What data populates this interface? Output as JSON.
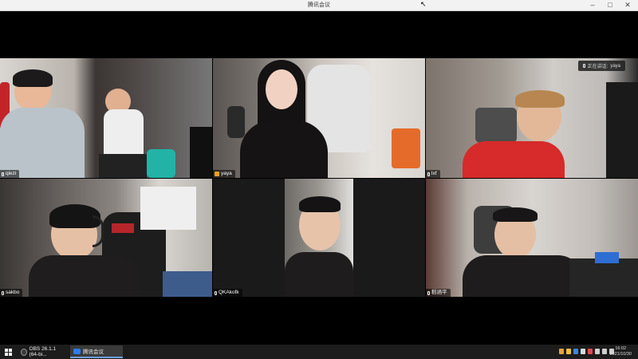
{
  "window": {
    "title": "腾讯会议"
  },
  "speaking": {
    "prefix": "正在讲话:",
    "name": "yaya"
  },
  "participants": [
    {
      "name": "qiezi",
      "active": false
    },
    {
      "name": "yaya",
      "active": true
    },
    {
      "name": "lxf",
      "active": false
    },
    {
      "name": "sakbo",
      "active": false
    },
    {
      "name": "QKAkofk",
      "active": false
    },
    {
      "name": "稻涵平",
      "active": false
    }
  ],
  "taskbar": {
    "items": [
      {
        "label": "OBS 26.1.1 (64-bi..."
      },
      {
        "label": "腾讯会议"
      }
    ],
    "time": "16:02",
    "date": "2021/10/30"
  },
  "colors": {
    "accent": "#26c26b",
    "mic_active": "#f0a020"
  }
}
